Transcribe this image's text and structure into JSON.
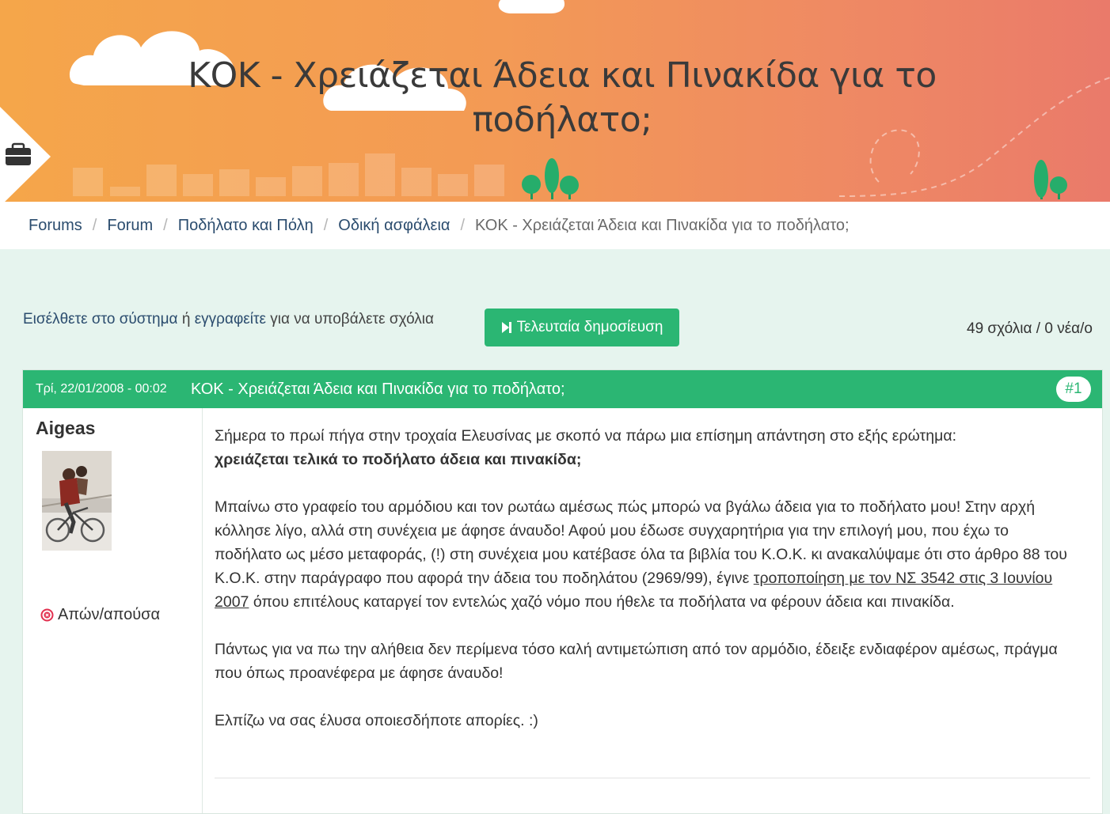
{
  "page": {
    "title": "ΚΟΚ - Χρειάζεται Άδεια και Πινακίδα για το ποδήλατο;"
  },
  "icons": {
    "side_tab": "briefcase-icon",
    "last_post": "skip-forward-icon",
    "offline": "close-circle-icon"
  },
  "colors": {
    "accent": "#2bb673",
    "banner_start": "#f5a64a",
    "banner_end": "#ea7a6a",
    "link": "#2b4c6e",
    "offline_status": "#e2304f"
  },
  "breadcrumb": {
    "sep": "/",
    "items": [
      "Forums",
      "Forum",
      "Ποδήλατο και Πόλη",
      "Οδική ασφάλεια",
      "ΚΟΚ - Χρειάζεται Άδεια και Πινακίδα για το ποδήλατο;"
    ]
  },
  "actions": {
    "login_link": "Εισέλθετε στο σύστημα",
    "or": "ή",
    "register_link": "εγγραφείτε",
    "suffix": "για να υποβάλετε σχόλια",
    "last_post_button": "Τελευταία δημοσίευση",
    "comment_count": "49 σχόλια / 0 νέα/ο"
  },
  "comment": {
    "date": "Τρί, 22/01/2008 - 00:02",
    "subject": "ΚΟΚ - Χρειάζεται Άδεια και Πινακίδα για το ποδήλατο;",
    "number": "#1",
    "author": "Aigeas",
    "status": "Απών/απούσα",
    "p1_text": "Σήμερα το πρωί πήγα στην τροχαία Ελευσίνας με σκοπό να πάρω μια επίσημη απάντηση στο εξής ερώτημα:",
    "p1_bold": "χρειάζεται τελικά το ποδήλατο άδεια και πινακίδα;",
    "p2_before": "Μπαίνω στο γραφείο του αρμόδιου και τον ρωτάω αμέσως πώς μπορώ να βγάλω άδεια για το ποδήλατο μου! Στην αρχή κόλλησε λίγο, αλλά στη συνέχεια με άφησε άναυδο! Αφού μου έδωσε συγχαρητήρια για την επιλογή μου, που έχω το ποδήλατο ως μέσο μεταφοράς, (!) στη συνέχεια μου κατέβασε όλα τα βιβλία του Κ.Ο.Κ. κι ανακαλύψαμε ότι στο άρθρο 88 του Κ.Ο.Κ. στην παράγραφο που αφορά την άδεια του ποδηλάτου (2969/99), έγινε",
    "p2_link": "τροποποίηση με τον ΝΣ 3542 στις 3 Ιουνίου 2007",
    "p2_after": "όπου επιτέλους καταργεί τον εντελώς χαζό νόμο που ήθελε τα ποδήλατα να φέρουν άδεια και πινακίδα.",
    "p3": "Πάντως για να πω την αλήθεια δεν περίμενα τόσο καλή αντιμετώπιση από τον αρμόδιο, έδειξε ενδιαφέρον αμέσως, πράγμα που όπως προανέφερα με άφησε άναυδο!",
    "p4": "Ελπίζω να σας έλυσα οποιεσδήποτε απορίες. :)"
  }
}
